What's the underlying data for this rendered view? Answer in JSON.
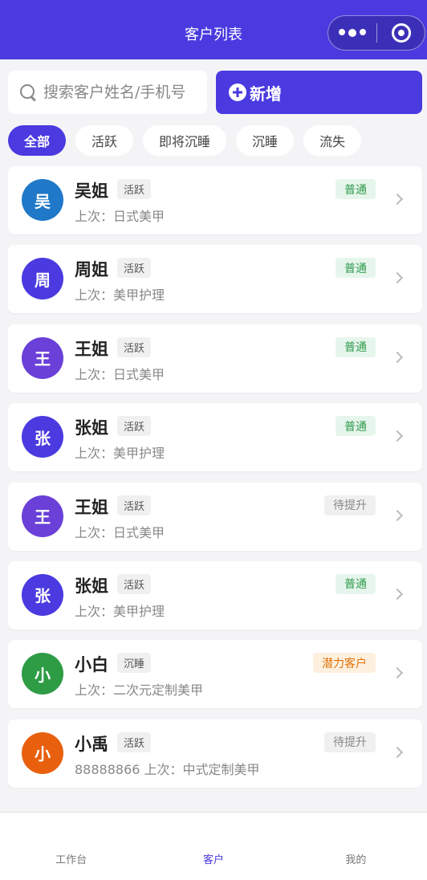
{
  "nav": {
    "title": "客户列表"
  },
  "search": {
    "placeholder": "搜索客户姓名/手机号",
    "add_label": "新增"
  },
  "filters": [
    {
      "label": "全部",
      "active": true
    },
    {
      "label": "活跃",
      "active": false
    },
    {
      "label": "即将沉睡",
      "active": false
    },
    {
      "label": "沉睡",
      "active": false
    },
    {
      "label": "流失",
      "active": false
    }
  ],
  "customers": [
    {
      "avatar": "吴",
      "name": "吴姐",
      "tag": "活跃",
      "sub": "上次：日式美甲",
      "level": "普通",
      "level_type": "normal",
      "color": "#1f78c8"
    },
    {
      "avatar": "周",
      "name": "周姐",
      "tag": "活跃",
      "sub": "上次：美甲护理",
      "level": "普通",
      "level_type": "normal",
      "color": "#4a3ae0"
    },
    {
      "avatar": "王",
      "name": "王姐",
      "tag": "活跃",
      "sub": "上次：日式美甲",
      "level": "普通",
      "level_type": "normal",
      "color": "#6a40d8"
    },
    {
      "avatar": "张",
      "name": "张姐",
      "tag": "活跃",
      "sub": "上次：美甲护理",
      "level": "普通",
      "level_type": "normal",
      "color": "#4a3ae0"
    },
    {
      "avatar": "王",
      "name": "王姐",
      "tag": "活跃",
      "sub": "上次：日式美甲",
      "level": "待提升",
      "level_type": "pending",
      "color": "#6a40d8"
    },
    {
      "avatar": "张",
      "name": "张姐",
      "tag": "活跃",
      "sub": "上次：美甲护理",
      "level": "普通",
      "level_type": "normal",
      "color": "#4a3ae0"
    },
    {
      "avatar": "小",
      "name": "小白",
      "tag": "沉睡",
      "sub": "上次：二次元定制美甲",
      "level": "潜力客户",
      "level_type": "potential",
      "color": "#2e9c45"
    },
    {
      "avatar": "小",
      "name": "小禹",
      "tag": "活跃",
      "sub": "88888866   上次：中式定制美甲",
      "level": "待提升",
      "level_type": "pending",
      "color": "#e8600e"
    }
  ],
  "tabbar": [
    {
      "label": "工作台",
      "active": false
    },
    {
      "label": "客户",
      "active": true
    },
    {
      "label": "我的",
      "active": false
    }
  ]
}
